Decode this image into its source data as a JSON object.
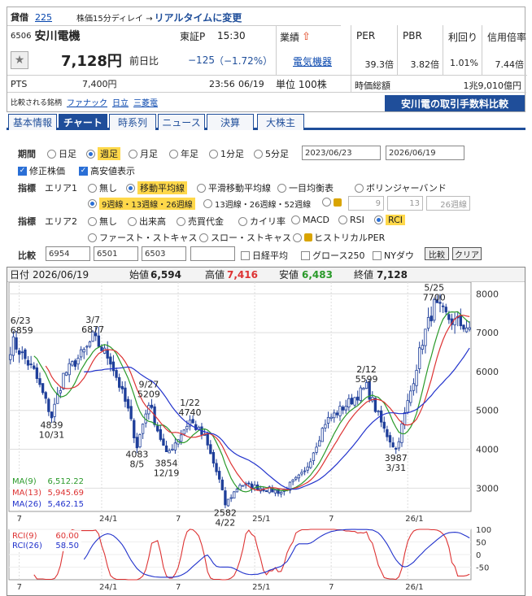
{
  "header": {
    "lending_label": "貸借",
    "lending_value": "225",
    "delay_note": "株価15分ディレイ →",
    "realtime_link": "リアルタイムに変更",
    "code": "6506",
    "name": "安川電機",
    "market": "東証P",
    "time": "15:30",
    "industry_label": "業績",
    "industry_value": "電気機器",
    "price": "7,128円",
    "change_label": "前日比",
    "change": "−125",
    "change_pct": "（−1.72%）",
    "pts_label": "PTS",
    "pts_price": "7,400円",
    "pts_time": "23:56",
    "pts_date": "06/19",
    "unit": "単位 100株",
    "compare_label": "比較される銘柄",
    "compare_stocks": [
      "ファナック",
      "日立",
      "三菱電"
    ],
    "fee_banner": "安川電の取引手数料比較",
    "metrics": [
      {
        "label": "PER",
        "value": "39.3倍"
      },
      {
        "label": "PBR",
        "value": "3.82倍"
      },
      {
        "label": "利回り",
        "value": "1.01%"
      },
      {
        "label": "信用倍率",
        "value": "7.44倍"
      }
    ],
    "market_cap_label": "時価総額",
    "market_cap": "1兆9,010億円"
  },
  "tabs": [
    "基本情報",
    "チャート",
    "時系列",
    "ニュース",
    "決算",
    "大株主"
  ],
  "controls": {
    "period_label": "期間",
    "periods": [
      "日足",
      "週足",
      "月足",
      "年足",
      "1分足",
      "5分足"
    ],
    "date_from": "2023/06/23",
    "date_to": "2026/06/19",
    "adj_label": "修正株価",
    "hilo_label": "高安値表示",
    "ind_label": "指標",
    "area1": "エリア1",
    "area1_opts": [
      "無し",
      "移動平均線",
      "平滑移動平均線",
      "一目均衡表",
      "ボリンジャーバンド"
    ],
    "ma_set1": "9週線・13週線・26週線",
    "ma_set2": "13週線・26週線・52週線",
    "ma_custom": [
      "9",
      "13",
      "26週線"
    ],
    "area2": "エリア2",
    "area2_opts": [
      "無し",
      "出来高",
      "売買代金",
      "カイリ率",
      "MACD",
      "RSI",
      "RCI"
    ],
    "area2_opts2": [
      "ファースト・ストキャス",
      "スロー・ストキャス",
      "ヒストリカルPER"
    ],
    "cmp_label": "比較",
    "cmp_codes": [
      "6954",
      "6501",
      "6503",
      ""
    ],
    "cmp_opts": [
      "日経平均",
      "グロース250",
      "NYダウ"
    ],
    "cmp_btn": "比較",
    "clear_btn": "クリア"
  },
  "chart_data": {
    "type": "candlestick",
    "info": {
      "date_label": "日付",
      "date": "2026/06/19",
      "open_label": "始値",
      "open": "6,594",
      "high_label": "高値",
      "high": "7,416",
      "low_label": "安値",
      "low": "6,483",
      "close_label": "終値",
      "close": "7,128"
    },
    "y_ticks": [
      "8000",
      "7000",
      "6000",
      "5000",
      "4000",
      "3000"
    ],
    "ylim": [
      2400,
      8300
    ],
    "x_ticks": [
      "7",
      "24/1",
      "7",
      "25/1",
      "7",
      "26/1"
    ],
    "x_tick_weeks": [
      3,
      31,
      57,
      83,
      109,
      135
    ],
    "weeks": 157,
    "anchors": [
      [
        0,
        6600
      ],
      [
        0,
        6859
      ],
      [
        8,
        6000
      ],
      [
        14,
        4839
      ],
      [
        18,
        5900
      ],
      [
        26,
        6600
      ],
      [
        28,
        6877
      ],
      [
        34,
        6300
      ],
      [
        40,
        5000
      ],
      [
        43,
        4083
      ],
      [
        47,
        5209
      ],
      [
        50,
        4500
      ],
      [
        53,
        3854
      ],
      [
        58,
        4400
      ],
      [
        61,
        4740
      ],
      [
        66,
        4300
      ],
      [
        71,
        3200
      ],
      [
        73,
        2582
      ],
      [
        78,
        3100
      ],
      [
        85,
        3000
      ],
      [
        92,
        2900
      ],
      [
        100,
        3400
      ],
      [
        107,
        4700
      ],
      [
        115,
        5200
      ],
      [
        121,
        5599
      ],
      [
        127,
        4500
      ],
      [
        131,
        3987
      ],
      [
        136,
        5500
      ],
      [
        140,
        6800
      ],
      [
        144,
        7700
      ],
      [
        150,
        7300
      ],
      [
        156,
        7128
      ]
    ],
    "annotations": [
      {
        "week": 0,
        "value": 6859,
        "date": "6/23",
        "price": "6859",
        "pos": "above"
      },
      {
        "week": 14,
        "value": 4839,
        "date": "10/31",
        "price": "4839",
        "pos": "below"
      },
      {
        "week": 28,
        "value": 6877,
        "date": "3/7",
        "price": "6877",
        "pos": "above"
      },
      {
        "week": 43,
        "value": 4083,
        "date": "8/5",
        "price": "4083",
        "pos": "below"
      },
      {
        "week": 47,
        "value": 5209,
        "date": "9/27",
        "price": "5209",
        "pos": "above"
      },
      {
        "week": 53,
        "value": 3854,
        "date": "12/19",
        "price": "3854",
        "pos": "below"
      },
      {
        "week": 61,
        "value": 4740,
        "date": "1/22",
        "price": "4740",
        "pos": "above"
      },
      {
        "week": 73,
        "value": 2582,
        "date": "4/22",
        "price": "2582",
        "pos": "below"
      },
      {
        "week": 121,
        "value": 5599,
        "date": "2/12",
        "price": "5599",
        "pos": "above"
      },
      {
        "week": 131,
        "value": 3987,
        "date": "3/31",
        "price": "3987",
        "pos": "below"
      },
      {
        "week": 144,
        "value": 7700,
        "date": "5/25",
        "price": "7700",
        "pos": "above"
      }
    ],
    "ma": [
      {
        "name": "MA(9)",
        "value": "6,512.22",
        "color": "#2a9a2a",
        "period": 9
      },
      {
        "name": "MA(13)",
        "value": "5,945.69",
        "color": "#d33",
        "period": 13
      },
      {
        "name": "MA(26)",
        "value": "5,462.15",
        "color": "#2233cc",
        "period": 26
      }
    ],
    "rci": {
      "series": [
        {
          "name": "RCI(9)",
          "value": "60.00",
          "color": "#d33"
        },
        {
          "name": "RCI(26)",
          "value": "58.50",
          "color": "#2233cc"
        }
      ],
      "y_ticks": [
        "100",
        "50",
        "0",
        "-50"
      ],
      "ylim": [
        -100,
        100
      ]
    },
    "colors": {
      "up": "#ffffff",
      "down": "#1f3f9a",
      "outline": "#1f3f9a"
    }
  },
  "colors": {
    "accent": "#1f4e9a",
    "negative": "#1f4e9a",
    "up_arrow": "#e0401a"
  }
}
